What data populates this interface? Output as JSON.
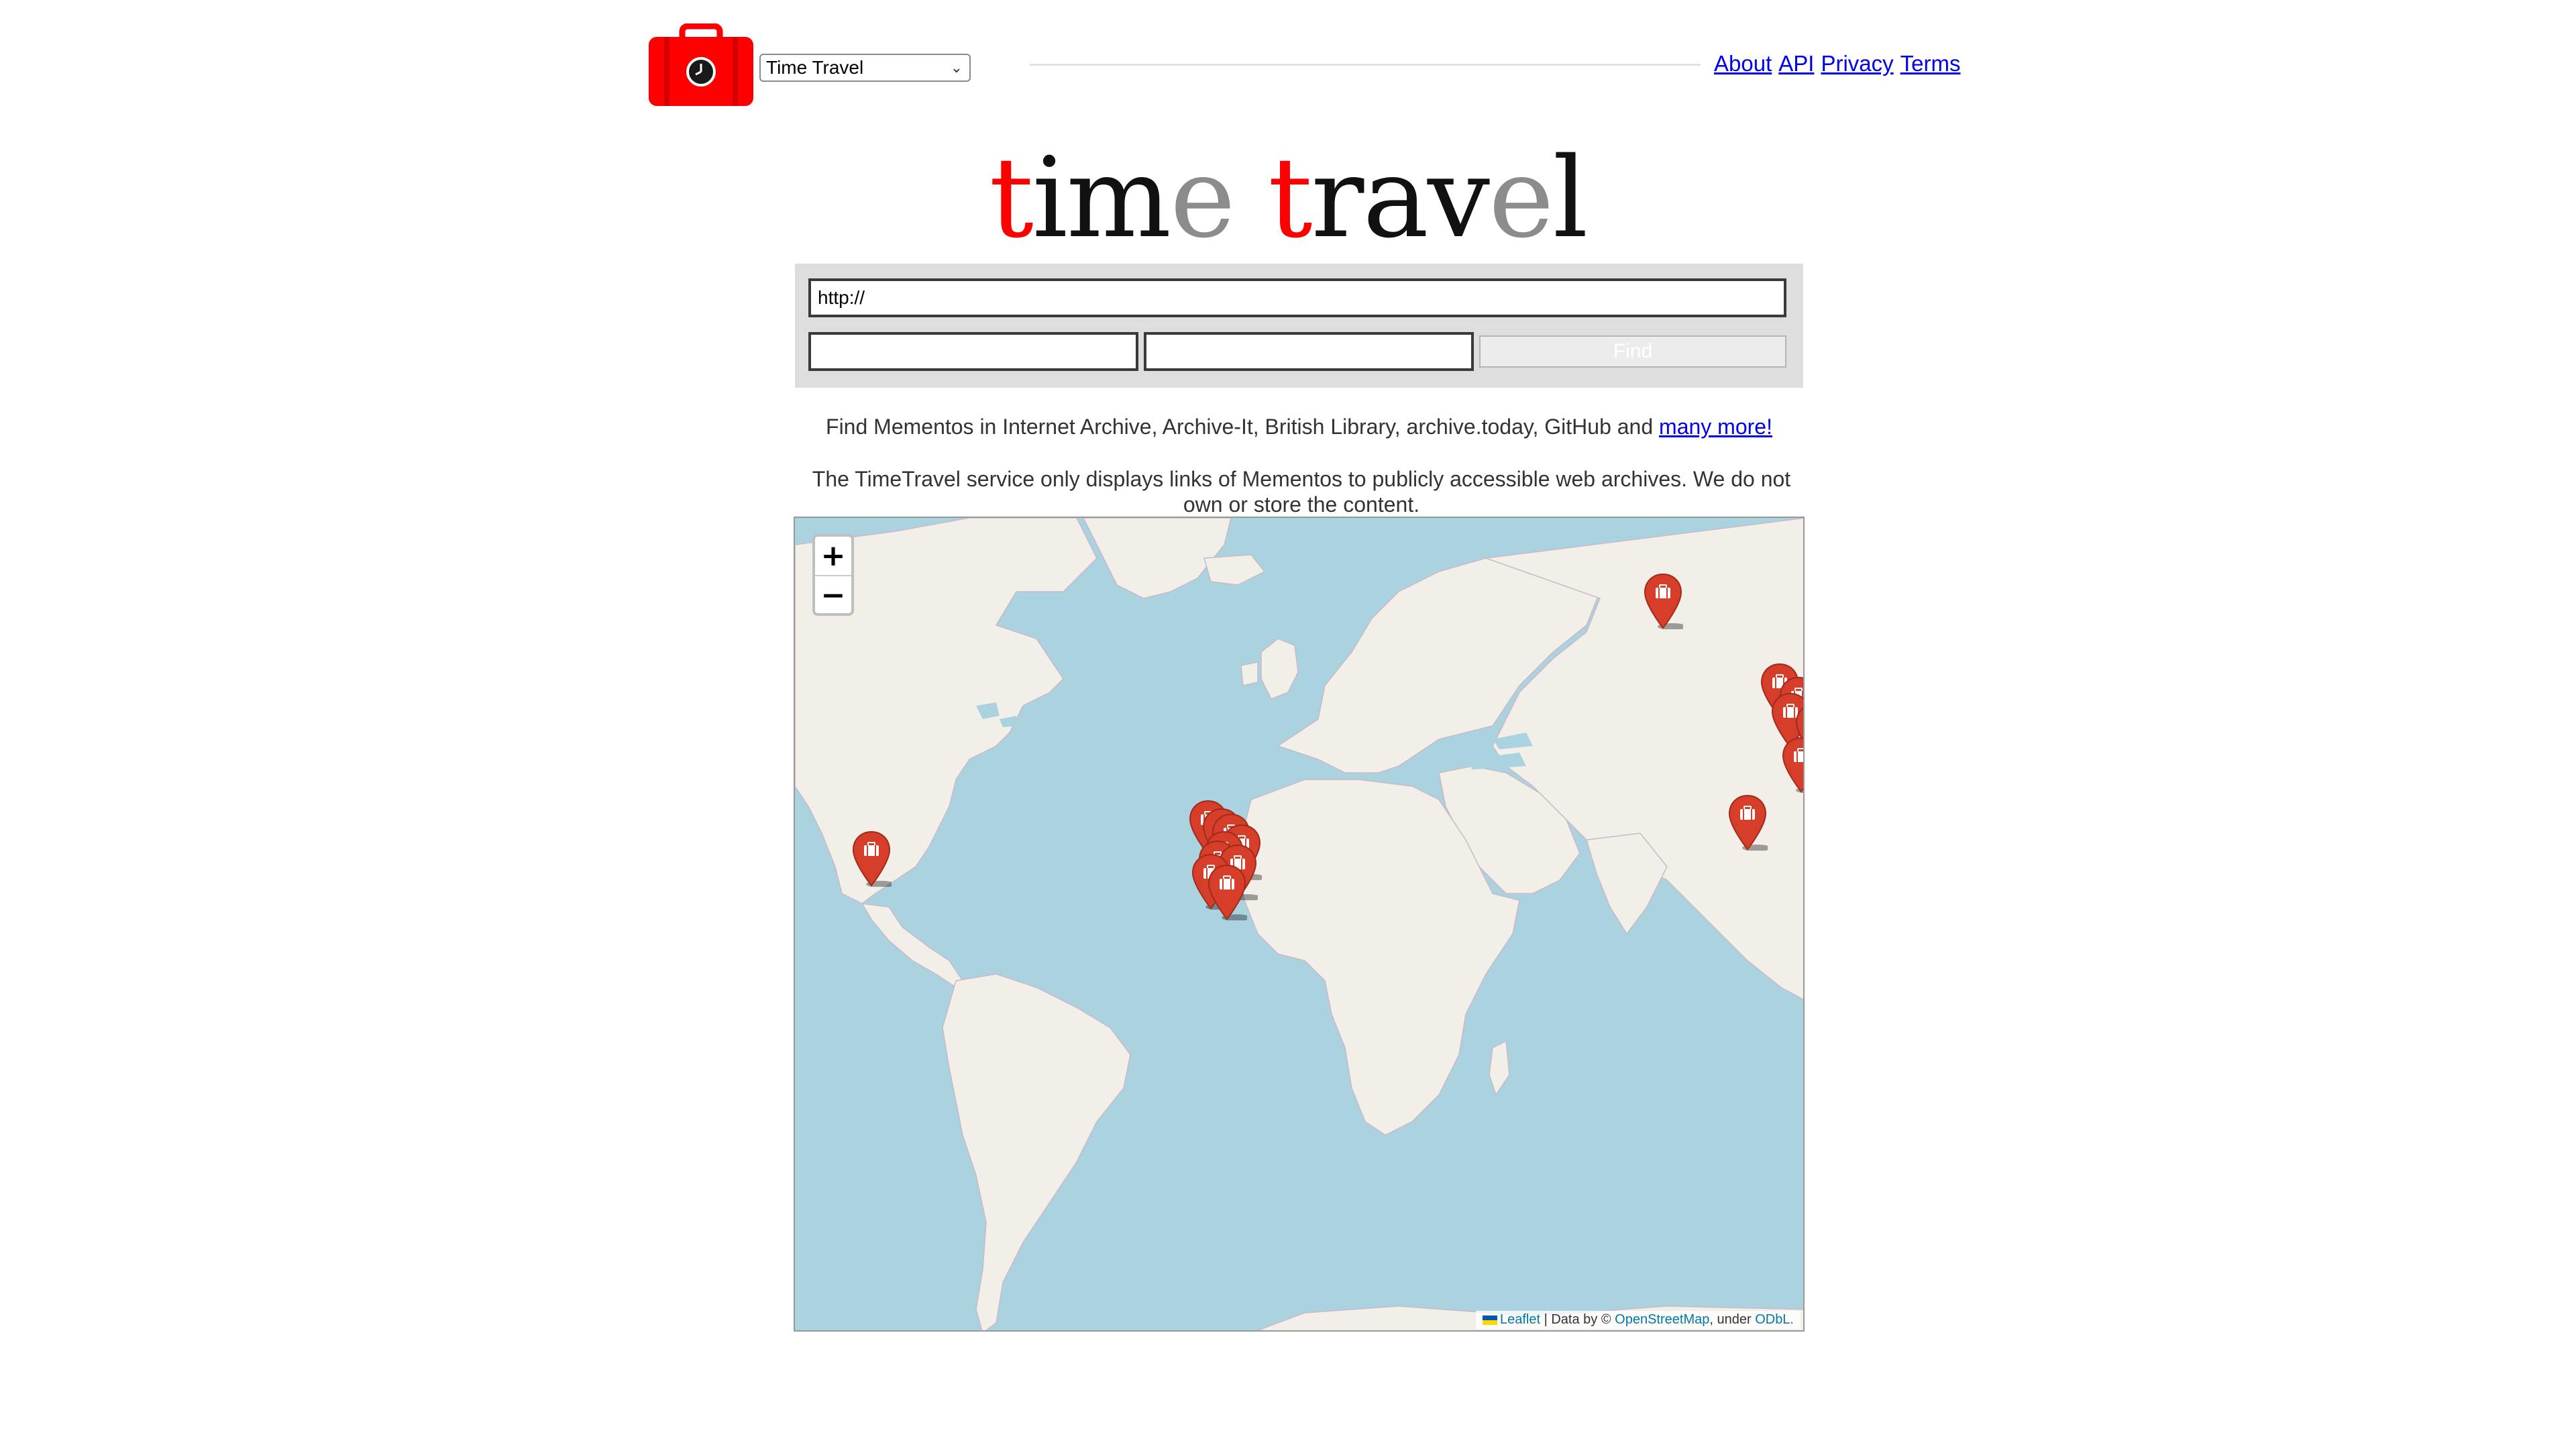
{
  "header": {
    "logo_alt": "Time Travel logo",
    "service_select": {
      "selected": "Time Travel"
    },
    "nav": [
      {
        "label": "About"
      },
      {
        "label": "API"
      },
      {
        "label": "Privacy"
      },
      {
        "label": "Terms"
      }
    ]
  },
  "title": {
    "letters": [
      {
        "ch": "t",
        "color": "#ff0000"
      },
      {
        "ch": "i",
        "color": "#111111"
      },
      {
        "ch": "m",
        "color": "#111111"
      },
      {
        "ch": "e",
        "color": "#8c8c8c"
      },
      {
        "ch": " ",
        "color": "#111111"
      },
      {
        "ch": "t",
        "color": "#ff0000"
      },
      {
        "ch": "r",
        "color": "#111111"
      },
      {
        "ch": "a",
        "color": "#111111"
      },
      {
        "ch": "v",
        "color": "#111111"
      },
      {
        "ch": "e",
        "color": "#8c8c8c"
      },
      {
        "ch": "l",
        "color": "#111111"
      }
    ]
  },
  "search": {
    "url_value": "http://",
    "date_value": "",
    "time_value": "",
    "find_label": "Find"
  },
  "description": {
    "line1_text": "Find Mementos in Internet Archive, Archive-It, British Library, archive.today, GitHub and",
    "line1_link": "many more!",
    "line2": "The TimeTravel service only displays links of Mementos to publicly accessible web archives. We do not own or store the content."
  },
  "map": {
    "zoom_in": "+",
    "zoom_out": "−",
    "attribution": {
      "leaflet": "Leaflet",
      "data_by": "| Data by ©",
      "osm": "OpenStreetMap",
      "under": ", under",
      "odbl": "ODbL."
    },
    "marker_color": "#d63e2a",
    "marker_count": 30
  },
  "colors": {
    "brand_red": "#ff0000",
    "link_blue": "#0000ee",
    "ocean": "#aad3df",
    "land": "#f2efe9"
  }
}
